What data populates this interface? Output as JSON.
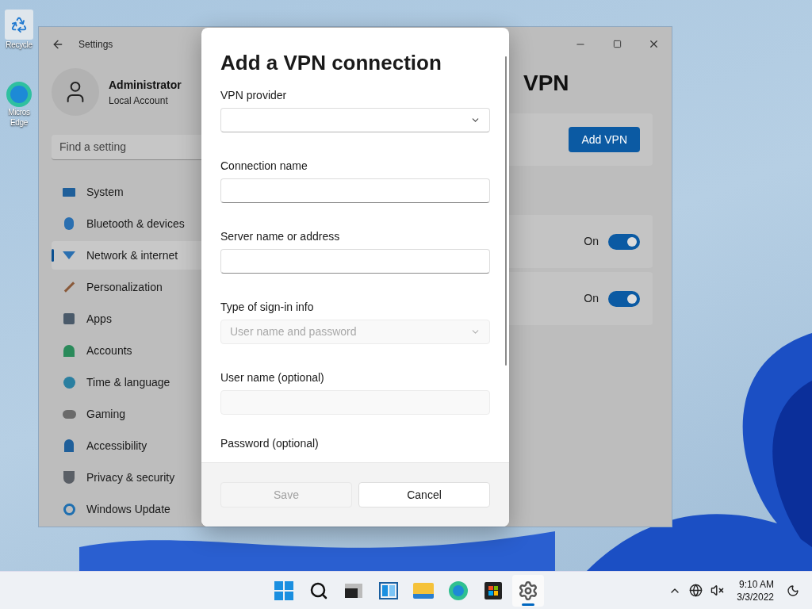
{
  "desktop_icons": [
    {
      "kind": "recycle",
      "lines": [
        "Recycle"
      ]
    },
    {
      "kind": "edge",
      "lines": [
        "Micros",
        "Edge"
      ]
    }
  ],
  "settings_window": {
    "title": "Settings",
    "user": {
      "name": "Administrator",
      "account_type": "Local Account"
    },
    "search": {
      "placeholder": "Find a setting"
    },
    "nav": [
      {
        "label": "System",
        "selected": false
      },
      {
        "label": "Bluetooth & devices",
        "selected": false
      },
      {
        "label": "Network & internet",
        "selected": true
      },
      {
        "label": "Personalization",
        "selected": false
      },
      {
        "label": "Apps",
        "selected": false
      },
      {
        "label": "Accounts",
        "selected": false
      },
      {
        "label": "Time & language",
        "selected": false
      },
      {
        "label": "Gaming",
        "selected": false
      },
      {
        "label": "Accessibility",
        "selected": false
      },
      {
        "label": "Privacy & security",
        "selected": false
      },
      {
        "label": "Windows Update",
        "selected": false
      }
    ],
    "page_title": "VPN",
    "add_button": "Add VPN",
    "toggles": [
      {
        "label": "On",
        "on": true
      },
      {
        "label": "On",
        "on": true
      }
    ]
  },
  "dialog": {
    "title": "Add a VPN connection",
    "fields": [
      {
        "label": "VPN provider",
        "kind": "select",
        "disabled": false
      },
      {
        "label": "Connection name",
        "kind": "text",
        "disabled": false
      },
      {
        "label": "Server name or address",
        "kind": "text",
        "disabled": false
      },
      {
        "label": "Type of sign-in info",
        "kind": "select",
        "placeholder": "User name and password",
        "disabled": true
      },
      {
        "label": "User name (optional)",
        "kind": "text",
        "disabled": true
      }
    ],
    "cut_label": "Password (optional)",
    "buttons": [
      {
        "label": "Save",
        "disabled": true
      },
      {
        "label": "Cancel",
        "disabled": false
      }
    ]
  },
  "taskbar": {
    "apps": [
      {
        "kind": "start",
        "active": false
      },
      {
        "kind": "search",
        "active": false
      },
      {
        "kind": "taskview",
        "active": false
      },
      {
        "kind": "widgets",
        "active": false
      },
      {
        "kind": "explorer",
        "active": false
      },
      {
        "kind": "edge",
        "active": false
      },
      {
        "kind": "store",
        "active": false
      },
      {
        "kind": "settings",
        "active": true
      }
    ],
    "clock": {
      "time": "9:10 AM",
      "date": "3/3/2022"
    }
  }
}
